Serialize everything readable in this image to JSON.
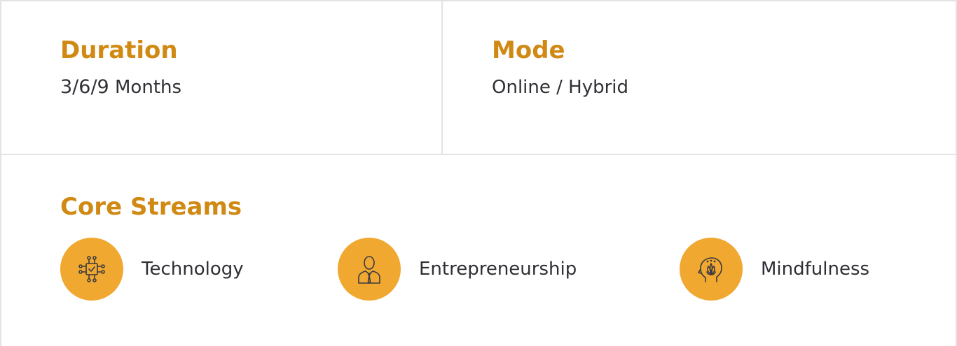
{
  "duration": {
    "heading": "Duration",
    "value_number": "3/6/9",
    "value_unit": "Months"
  },
  "mode": {
    "heading": "Mode",
    "value": "Online / Hybrid"
  },
  "core_streams": {
    "heading": "Core Streams",
    "items": [
      {
        "label": "Technology",
        "icon": "circuit-chip-icon"
      },
      {
        "label": "Entrepreneurship",
        "icon": "businessman-icon"
      },
      {
        "label": "Mindfulness",
        "icon": "mind-lotus-icon"
      }
    ]
  },
  "colors": {
    "heading": "#d08a14",
    "icon_bg": "#f0a830",
    "text": "#2f2f35",
    "border": "#e3e3e3"
  }
}
